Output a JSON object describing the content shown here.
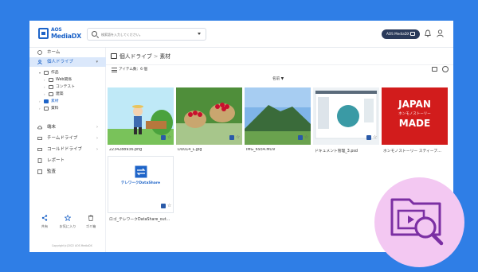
{
  "brand": {
    "line1": "AOS",
    "line2": "MediaDX"
  },
  "search": {
    "placeholder": "検索語を入力してください。"
  },
  "header": {
    "account_label": "AOS MediaDX"
  },
  "sidebar": {
    "nav": [
      {
        "label": "ホーム"
      },
      {
        "label": "個人ドライブ"
      },
      {
        "label": "端末"
      },
      {
        "label": "チームドライブ"
      },
      {
        "label": "コールドドライブ"
      },
      {
        "label": "レポート"
      },
      {
        "label": "監査"
      }
    ],
    "tree": [
      {
        "label": "作品"
      },
      {
        "label": "Web関係"
      },
      {
        "label": "コンテスト"
      },
      {
        "label": "建築"
      },
      {
        "label": "素材"
      },
      {
        "label": "資料"
      }
    ],
    "actions": [
      {
        "label": "共有"
      },
      {
        "label": "お気に入り"
      },
      {
        "label": "ゴミ箱"
      }
    ],
    "copyright": "Copyright(c)2022 AOS MediaDX"
  },
  "breadcrumb": {
    "root": "個人ドライブ",
    "sep": ">",
    "current": "素材"
  },
  "toolbar": {
    "item_count": "アイテム数：6 個",
    "sort_label": "名前 ▼"
  },
  "files": [
    {
      "name": "2234288936.png"
    },
    {
      "name": "DU014_L.jpg"
    },
    {
      "name": "IMG_6934.MOV"
    },
    {
      "name": "ドキュメント管理_3.psd"
    },
    {
      "name": "ホンモノストーリー スティーブ…"
    },
    {
      "name": "ロゴ_テレワークDataShare_out…"
    }
  ],
  "thumb_texts": {
    "japan_line1": "JAPAN",
    "japan_line2": "ホンモノストーリー",
    "japan_line3": "MADE",
    "logo_text": "テレワークDataShare"
  },
  "colors": {
    "accent": "#1e64c8",
    "background": "#2f7ee6",
    "active_nav": "#dbe8fb",
    "overlay": "#f3c8f2"
  }
}
